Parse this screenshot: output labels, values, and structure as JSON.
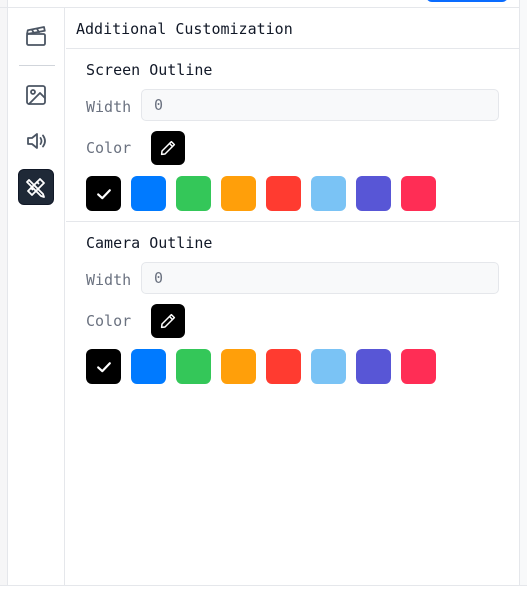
{
  "rail": {
    "items": [
      {
        "name": "clapperboard-icon",
        "active": false
      },
      {
        "name": "image-icon",
        "active": false
      },
      {
        "name": "speaker-icon",
        "active": false
      },
      {
        "name": "pencil-ruler-icon",
        "active": true
      }
    ]
  },
  "panel": {
    "title": "Additional Customization"
  },
  "sections": [
    {
      "title": "Screen Outline",
      "width_label": "Width",
      "width_value": "0",
      "color_label": "Color",
      "picker_icon": "pencil-icon",
      "swatches": [
        {
          "name": "black",
          "color": "#000000",
          "selected": true
        },
        {
          "name": "blue",
          "color": "#007aff",
          "selected": false
        },
        {
          "name": "green",
          "color": "#34c759",
          "selected": false
        },
        {
          "name": "orange",
          "color": "#ff9f0a",
          "selected": false
        },
        {
          "name": "red",
          "color": "#ff3b30",
          "selected": false
        },
        {
          "name": "light-blue",
          "color": "#7ac3f5",
          "selected": false
        },
        {
          "name": "indigo",
          "color": "#5856d6",
          "selected": false
        },
        {
          "name": "pink",
          "color": "#ff2d55",
          "selected": false
        }
      ]
    },
    {
      "title": "Camera Outline",
      "width_label": "Width",
      "width_value": "0",
      "color_label": "Color",
      "picker_icon": "pencil-icon",
      "swatches": [
        {
          "name": "black",
          "color": "#000000",
          "selected": true
        },
        {
          "name": "blue",
          "color": "#007aff",
          "selected": false
        },
        {
          "name": "green",
          "color": "#34c759",
          "selected": false
        },
        {
          "name": "orange",
          "color": "#ff9f0a",
          "selected": false
        },
        {
          "name": "red",
          "color": "#ff3b30",
          "selected": false
        },
        {
          "name": "light-blue",
          "color": "#7ac3f5",
          "selected": false
        },
        {
          "name": "indigo",
          "color": "#5856d6",
          "selected": false
        },
        {
          "name": "pink",
          "color": "#ff2d55",
          "selected": false
        }
      ]
    }
  ]
}
